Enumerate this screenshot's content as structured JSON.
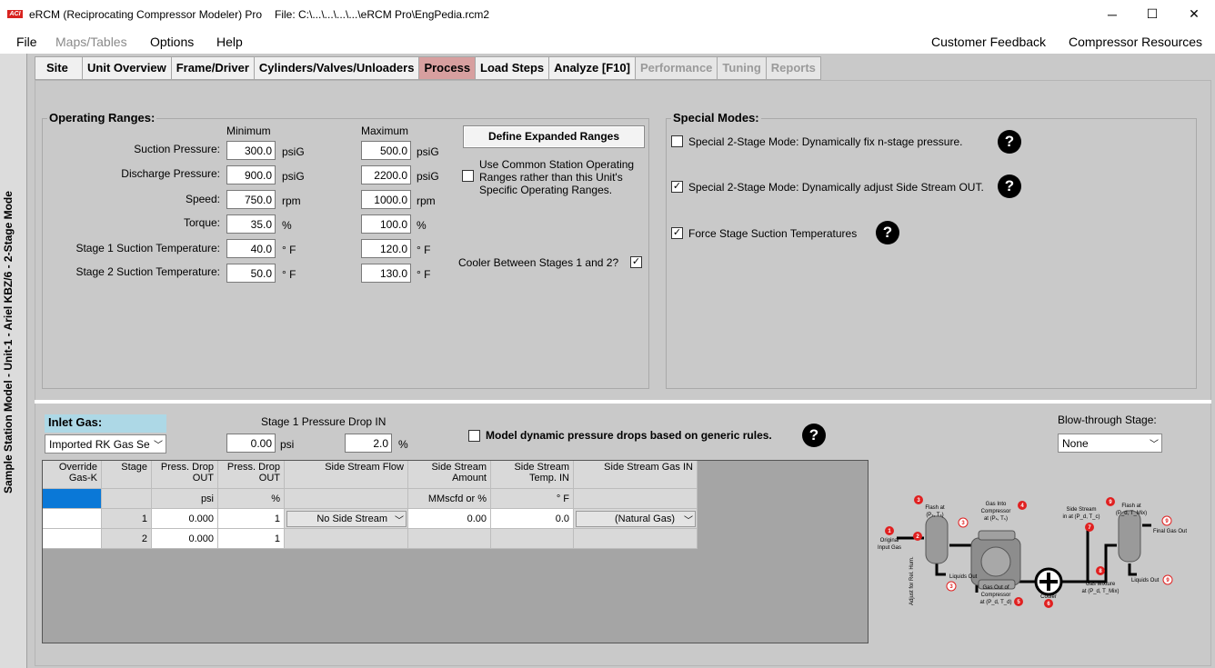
{
  "window": {
    "logo_text": "ACI",
    "app_title": "eRCM (Reciprocating Compressor Modeler) Pro",
    "file_title": "File: C:\\...\\...\\...\\...\\eRCM Pro\\EngPedia.rcm2",
    "minimize": "─",
    "maximize": "☐",
    "close": "✕"
  },
  "menu": {
    "file": "File",
    "maps_tables": "Maps/Tables",
    "options": "Options",
    "help": "Help",
    "customer_feedback": "Customer Feedback",
    "compressor_resources": "Compressor Resources"
  },
  "vertical_title": "Sample Station Model - Unit-1 - Ariel KBZ/6 - 2-Stage Mode",
  "tabs": [
    {
      "label": "Site"
    },
    {
      "label": "Unit Overview"
    },
    {
      "label": "Frame/Driver"
    },
    {
      "label": "Cylinders/Valves/Unloaders"
    },
    {
      "label": "Process"
    },
    {
      "label": "Load Steps"
    },
    {
      "label": "Analyze [F10]"
    },
    {
      "label": "Performance"
    },
    {
      "label": "Tuning"
    },
    {
      "label": "Reports"
    }
  ],
  "operating_ranges": {
    "title": "Operating Ranges:",
    "minimum": "Minimum",
    "maximum": "Maximum",
    "rows": [
      {
        "label": "Suction Pressure:",
        "min": "300.0",
        "min_unit": "psiG",
        "max": "500.0",
        "max_unit": "psiG"
      },
      {
        "label": "Discharge Pressure:",
        "min": "900.0",
        "min_unit": "psiG",
        "max": "2200.0",
        "max_unit": "psiG"
      },
      {
        "label": "Speed:",
        "min": "750.0",
        "min_unit": "rpm",
        "max": "1000.0",
        "max_unit": "rpm"
      },
      {
        "label": "Torque:",
        "min": "35.0",
        "min_unit": "%",
        "max": "100.0",
        "max_unit": "%"
      },
      {
        "label": "Stage 1 Suction Temperature:",
        "min": "40.0",
        "min_unit": "° F",
        "max": "120.0",
        "max_unit": "° F"
      },
      {
        "label": "Stage 2 Suction Temperature:",
        "min": "50.0",
        "min_unit": "° F",
        "max": "130.0",
        "max_unit": "° F"
      }
    ],
    "define_expanded": "Define Expanded Ranges",
    "use_common_l1": "Use Common Station Operating",
    "use_common_l2": "Ranges rather than this Unit's",
    "use_common_l3": "Specific Operating Ranges.",
    "use_common_checked": "",
    "cooler_label": "Cooler Between Stages 1 and 2?",
    "cooler_checked": "✓"
  },
  "special_modes": {
    "title": "Special Modes:",
    "items": [
      {
        "label": "Special 2-Stage Mode: Dynamically fix n-stage pressure.",
        "checked": ""
      },
      {
        "label": "Special 2-Stage Mode: Dynamically adjust Side Stream OUT.",
        "checked": "✓"
      },
      {
        "label": "Force Stage Suction Temperatures",
        "checked": "✓"
      }
    ],
    "help_glyph": "?"
  },
  "inlet": {
    "title": "Inlet Gas:",
    "selected": "Imported RK Gas Se",
    "pressure_drop_title": "Stage 1 Pressure Drop IN",
    "drop_psi": "0.00",
    "drop_psi_unit": "psi",
    "drop_pct": "2.0",
    "drop_pct_unit": "%",
    "dynamic_label": "Model dynamic pressure drops based on generic rules.",
    "dynamic_checked": "",
    "blowthrough_label": "Blow-through Stage:",
    "blowthrough_value": "None"
  },
  "grid": {
    "headers": [
      [
        "Override",
        "Gas-K"
      ],
      [
        "Stage",
        ""
      ],
      [
        "Press. Drop",
        "OUT"
      ],
      [
        "Press. Drop",
        "OUT"
      ],
      [
        "Side Stream Flow",
        ""
      ],
      [
        "Side Stream",
        "Amount"
      ],
      [
        "Side Stream",
        "Temp. IN"
      ],
      [
        "Side Stream Gas IN",
        ""
      ]
    ],
    "units": [
      "",
      "",
      "psi",
      "%",
      "",
      "MMscfd or %",
      "° F",
      ""
    ],
    "rows": [
      {
        "override": "",
        "stage": "1",
        "drop_psi": "0.000",
        "drop_pct": "1",
        "flow": "No Side Stream",
        "amount": "0.00",
        "temp": "0.0",
        "gas": "(Natural Gas)"
      },
      {
        "override": "",
        "stage": "2",
        "drop_psi": "0.000",
        "drop_pct": "1",
        "flow": "",
        "amount": "",
        "temp": "",
        "gas": ""
      }
    ]
  },
  "diagram": {
    "labels": {
      "flash1": "Flash at",
      "flash1_sub": "(Pₛ, Tₛ)",
      "original": "Original",
      "input_gas": "Input Gas",
      "adjust": "Adjust for Rel. Hum.",
      "liquids_out_1": "Liquids Out",
      "gas_into_1": "Gas Into",
      "gas_into_2": "Compressor",
      "gas_into_3": "at (Pₛ, Tₛ)",
      "gas_out_1": "Gas Out of",
      "gas_out_2": "Compressor",
      "gas_out_3": "at (P_d, T_d)",
      "cooler": "Cooler",
      "side_stream_1": "Side Stream",
      "side_stream_2": "in at (P_d, T_c)",
      "gas_mix_1": "Gas Mixture",
      "gas_mix_2": "at (P_d, T_Mix)",
      "flash2": "Flash at",
      "flash2_sub": "(P_d, T_Mix)",
      "final_gas": "Final Gas Out",
      "liquids_out_2": "Liquids Out"
    },
    "markers": [
      "1",
      "2",
      "3",
      "3",
      "3",
      "4",
      "5",
      "6",
      "7",
      "8",
      "9",
      "9",
      "9"
    ]
  },
  "colors": {
    "active_tab": "#d79f9f",
    "panel": "#c9c9c9",
    "selection": "#0a78d7",
    "marker": "#e02020"
  }
}
